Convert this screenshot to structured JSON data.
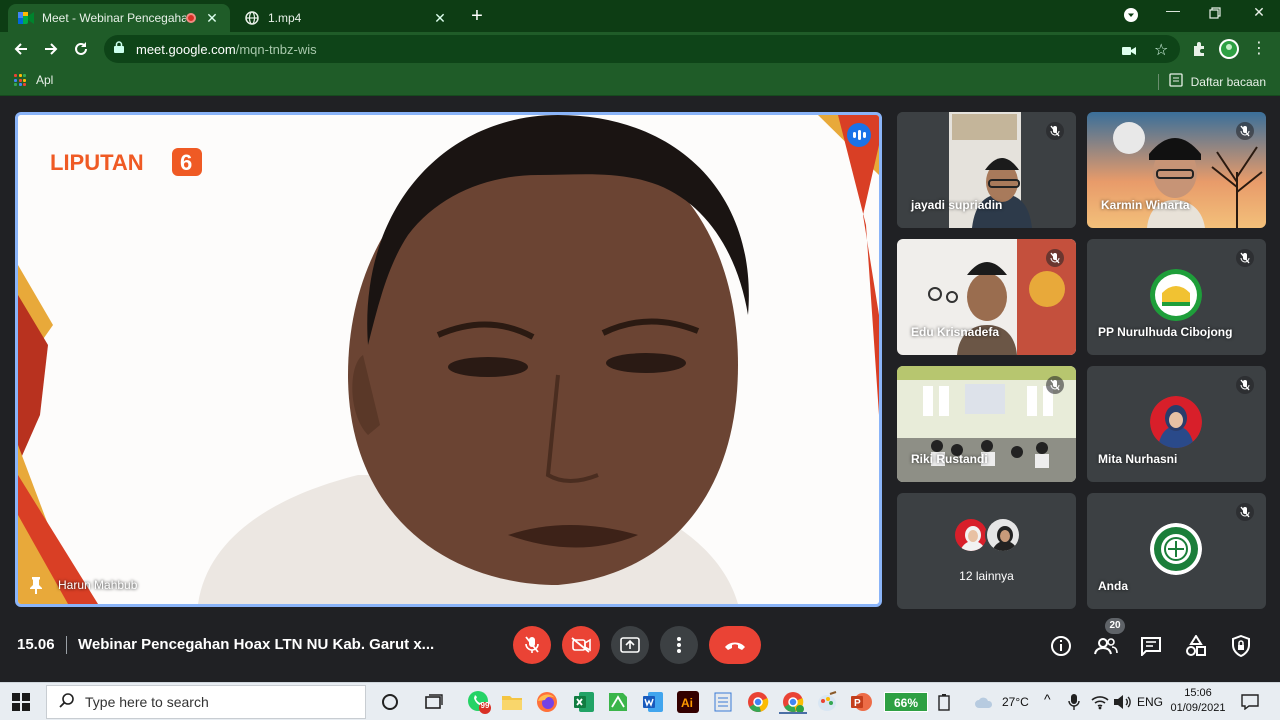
{
  "browser": {
    "tabs": [
      {
        "label": "Meet - Webinar Pencegahan",
        "active": true
      },
      {
        "label": "1.mp4",
        "active": false
      }
    ],
    "url_host": "meet.google.com",
    "url_path": "/mqn-tnbz-wis",
    "bookmarks_apps_label": "Apl",
    "reading_list_label": "Daftar bacaan"
  },
  "meet": {
    "main_speaker": {
      "name": "Harun Mahbub",
      "logo_text": "LIPUTAN",
      "logo_digit": "6"
    },
    "participants": [
      {
        "name": "jayadi supriadin",
        "muted": true
      },
      {
        "name": "Karmin Winarta",
        "muted": true
      },
      {
        "name": "Edu Krisnadefa",
        "muted": true
      },
      {
        "name": "PP Nurulhuda Cibojong",
        "muted": true
      },
      {
        "name": "Riki Rustandi",
        "muted": true
      },
      {
        "name": "Mita Nurhasni",
        "muted": true
      },
      {
        "name": "Anda",
        "muted": true
      }
    ],
    "others_label": "12 lainnya",
    "bottom": {
      "time": "15.06",
      "title": "Webinar Pencegahan Hoax LTN NU Kab. Garut x...",
      "participant_count": "20"
    }
  },
  "taskbar": {
    "search_placeholder": "Type here to search",
    "whatsapp_badge": "99",
    "battery": "66%",
    "temperature": "27°C",
    "language": "ENG",
    "clock_time": "15:06",
    "clock_date": "01/09/2021"
  },
  "colors": {
    "chrome_dark": "#0d3d14",
    "chrome": "#1f5c28",
    "meet_bg": "#202124",
    "tile_bg": "#3c4043",
    "red": "#ea4335",
    "speaking_border": "#8ab4f8"
  }
}
